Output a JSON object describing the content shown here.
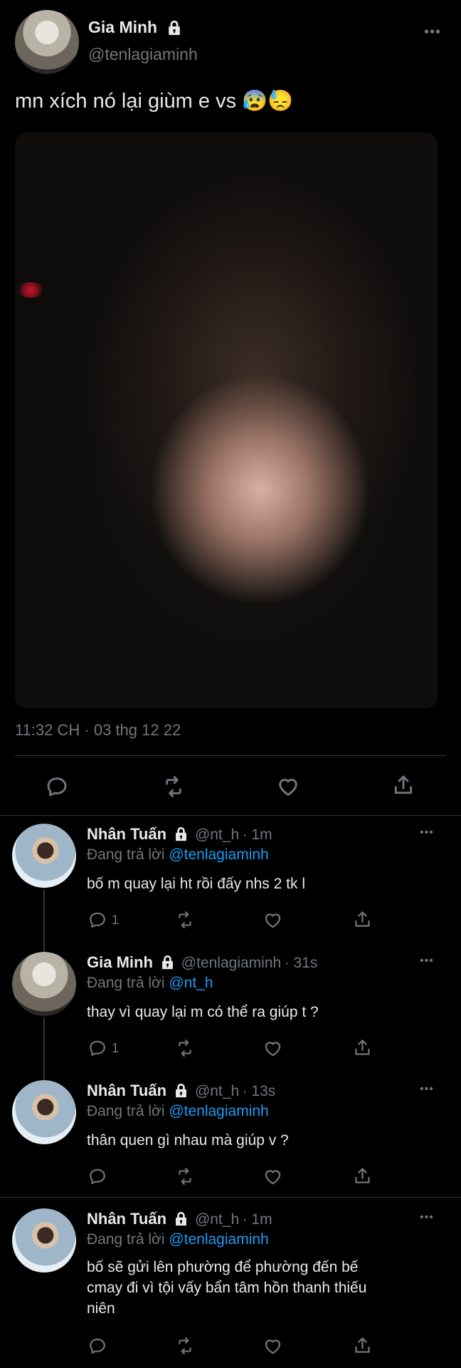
{
  "main_tweet": {
    "name": "Gia Minh",
    "handle": "@tenlagiaminh",
    "text": "mn xích nó lại giùm e vs 😰😓",
    "timestamp": "11:32 CH · 03 thg 12 22",
    "more_label": "•••"
  },
  "replies": [
    {
      "name": "Nhân Tuấn",
      "handle": "@nt_h",
      "time": "· 1m",
      "replying_label": "Đang trả lời",
      "replying_to": "@tenlagiaminh",
      "text": "bố m quay lại ht rồi đấy nhs 2 tk l",
      "reply_count": "1",
      "more_label": "•••"
    },
    {
      "name": "Gia Minh",
      "handle": "@tenlagiaminh",
      "time": "· 31s",
      "replying_label": "Đang trả lời",
      "replying_to": "@nt_h",
      "text": "thay vì quay lại m có thể ra giúp t ?",
      "reply_count": "1",
      "more_label": "•••"
    },
    {
      "name": "Nhân Tuấn",
      "handle": "@nt_h",
      "time": "· 13s",
      "replying_label": "Đang trả lời",
      "replying_to": "@tenlagiaminh",
      "text": "thân quen gì nhau mà giúp v ?",
      "reply_count": "",
      "more_label": "•••"
    },
    {
      "name": "Nhân Tuấn",
      "handle": "@nt_h",
      "time": "· 1m",
      "replying_label": "Đang trả lời",
      "replying_to": "@tenlagiaminh",
      "text_lines": [
        "bố sẽ gửi lên phường để phường đến bế",
        "cmay đi vì tội vấy bẩn tâm hồn thanh thiếu",
        "niên"
      ],
      "reply_count": "",
      "more_label": "•••"
    }
  ],
  "icons": [
    "lock-icon",
    "reply-icon",
    "retweet-icon",
    "like-icon",
    "share-icon",
    "more-icon"
  ],
  "colors": {
    "background": "#000000",
    "text": "#e7e9ea",
    "muted": "#71767b",
    "link": "#1d9bf0",
    "divider": "#2f3336"
  }
}
